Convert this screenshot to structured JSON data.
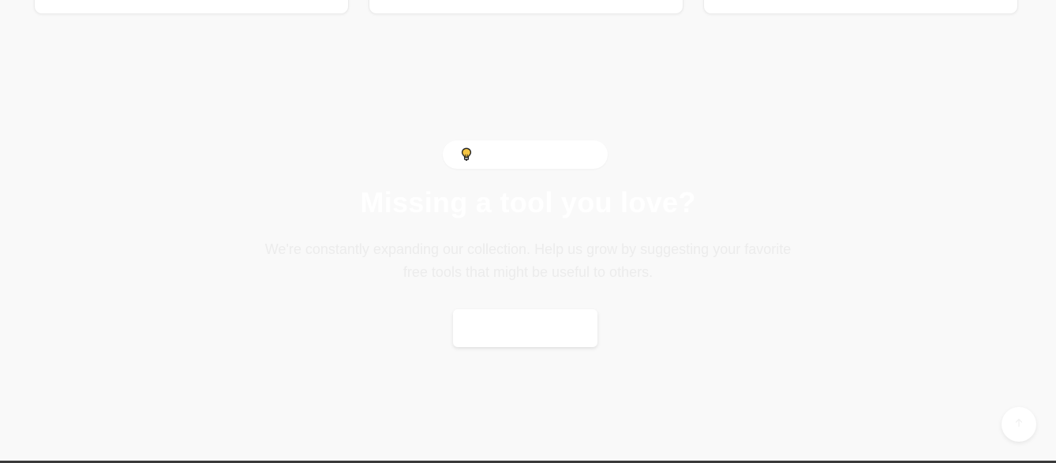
{
  "cards": [
    {
      "title": ""
    },
    {
      "title": ""
    },
    {
      "title": ""
    }
  ],
  "cta": {
    "badge_icon": "lightbulb-icon",
    "badge_label": "",
    "title": "Missing a tool you love?",
    "description": "We're constantly expanding our collection. Help us grow by suggesting your favorite free tools that might be useful to others.",
    "button_label": ""
  },
  "back_to_top": {
    "icon": "arrow-up-icon"
  },
  "colors": {
    "page_background": "#f9f9f9",
    "card_background": "#ffffff",
    "bulb_fill": "#f5c542",
    "footer": "#3a3a3a"
  }
}
